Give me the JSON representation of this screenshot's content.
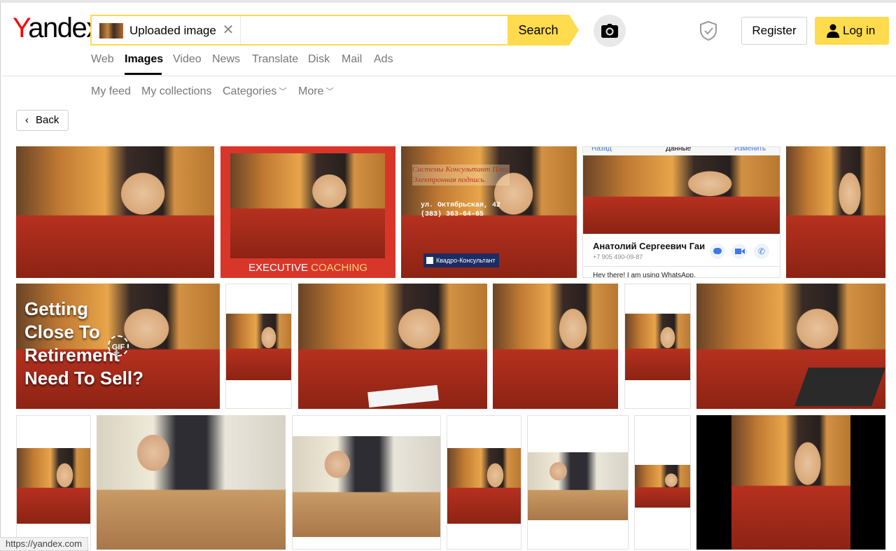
{
  "logo": {
    "first": "Y",
    "rest": "andex"
  },
  "search": {
    "chip_label": "Uploaded image",
    "query": "",
    "button": "Search"
  },
  "header": {
    "register": "Register",
    "login": "Log in"
  },
  "tabs": [
    {
      "label": "Web"
    },
    {
      "label": "Images"
    },
    {
      "label": "Video"
    },
    {
      "label": "News"
    },
    {
      "label": "Translate"
    },
    {
      "label": "Disk"
    },
    {
      "label": "Mail"
    },
    {
      "label": "Ads"
    }
  ],
  "subnav": {
    "feed": "My feed",
    "collections": "My collections",
    "categories": "Categories",
    "more": "More"
  },
  "back": "Back",
  "results": {
    "r1_2": {
      "caption_a": "EXECUTIVE",
      "caption_b": "COACHING"
    },
    "r1_3": {
      "line1": "Системы Консультант Плюс",
      "line2": "Электронная подпись.",
      "line3": "ул. Октябрьская, 42",
      "line4": "(383) 363-64-65",
      "brand": "Квадро-Консультант"
    },
    "r1_4": {
      "top_left": "Назад",
      "top_center": "Данные",
      "top_right": "Изменить",
      "name": "Анатолий Сергеевич Гаи",
      "phone": "+7 905 490-09-87",
      "status": "Hey there! I am using WhatsApp."
    },
    "r2_1": {
      "line1": "Getting",
      "line2": "Close To",
      "line3": "Retirement",
      "line4": "Need To Sell?",
      "badge": "GIF"
    }
  },
  "status_url": "https://yandex.com"
}
